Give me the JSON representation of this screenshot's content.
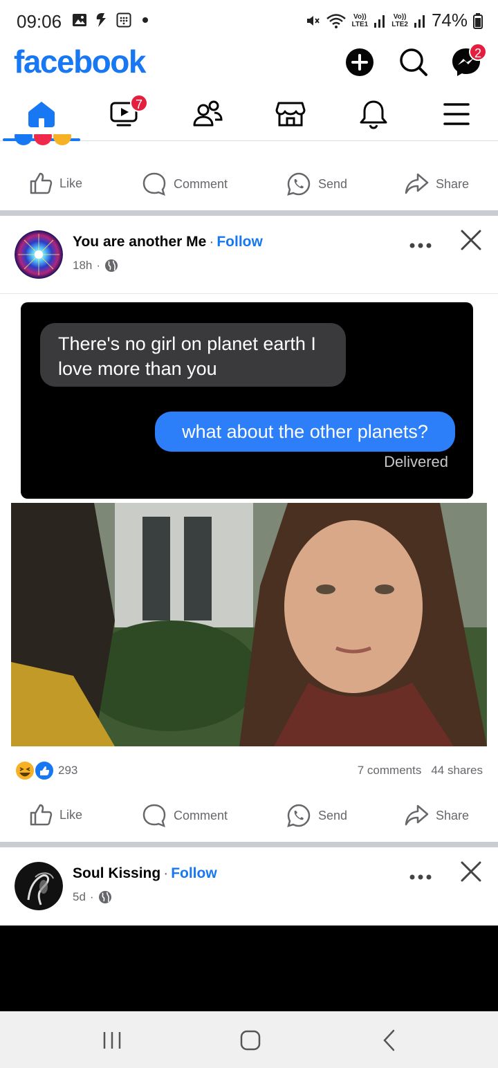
{
  "status_bar": {
    "time": "09:06",
    "battery": "74%",
    "sim1": "LTE1",
    "sim2": "LTE2",
    "volte": "Vo))"
  },
  "header": {
    "logo": "facebook",
    "messenger_badge": "2",
    "icons": [
      "plus-icon",
      "search-icon",
      "messenger-icon"
    ]
  },
  "tabs": {
    "items": [
      "home-tab",
      "video-tab",
      "friends-tab",
      "marketplace-tab",
      "notifications-tab",
      "menu-tab"
    ],
    "video_badge": "7",
    "active": "home-tab"
  },
  "action_labels": {
    "like": "Like",
    "comment": "Comment",
    "send": "Send",
    "share": "Share"
  },
  "posts": [
    {
      "author": "You are another Me",
      "follow": "Follow",
      "separator": "·",
      "time": "18h",
      "image": {
        "received_line1": "There's no girl on planet earth I",
        "received_line2": "love more than you",
        "sent": "what about the other planets?",
        "status": "Delivered"
      },
      "reactions_count": "293",
      "comments": "7 comments",
      "shares": "44 shares"
    },
    {
      "author": "Soul Kissing",
      "follow": "Follow",
      "separator": "·",
      "time": "5d"
    }
  ],
  "colors": {
    "brand": "#1877f2",
    "badge": "#e41e3f",
    "meta_text": "#65676b",
    "divider": "#c9ccd1"
  }
}
